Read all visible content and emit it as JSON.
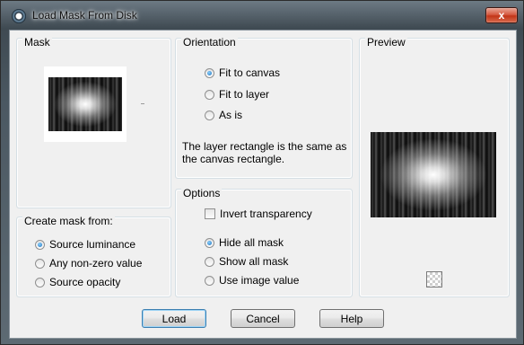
{
  "window": {
    "title": "Load Mask From Disk",
    "close_label": "x"
  },
  "mask_group": {
    "title": "Mask"
  },
  "orientation": {
    "title": "Orientation",
    "options": [
      {
        "label": "Fit to canvas",
        "selected": true
      },
      {
        "label": "Fit to layer",
        "selected": false
      },
      {
        "label": "As is",
        "selected": false
      }
    ],
    "description": "The layer rectangle is the same as the canvas rectangle."
  },
  "preview": {
    "title": "Preview",
    "transparency_icon": "checkerboard-icon"
  },
  "create_mask": {
    "title": "Create mask from:",
    "options": [
      {
        "label": "Source luminance",
        "selected": true
      },
      {
        "label": "Any non-zero value",
        "selected": false
      },
      {
        "label": "Source opacity",
        "selected": false
      }
    ]
  },
  "options": {
    "title": "Options",
    "invert_label": "Invert transparency",
    "invert_checked": false,
    "hide_show": [
      {
        "label": "Hide all mask",
        "selected": true
      },
      {
        "label": "Show all mask",
        "selected": false
      },
      {
        "label": "Use image value",
        "selected": false
      }
    ]
  },
  "buttons": {
    "load": "Load",
    "cancel": "Cancel",
    "help": "Help"
  },
  "colors": {
    "accent": "#1d6fb8",
    "close": "#c23518"
  }
}
